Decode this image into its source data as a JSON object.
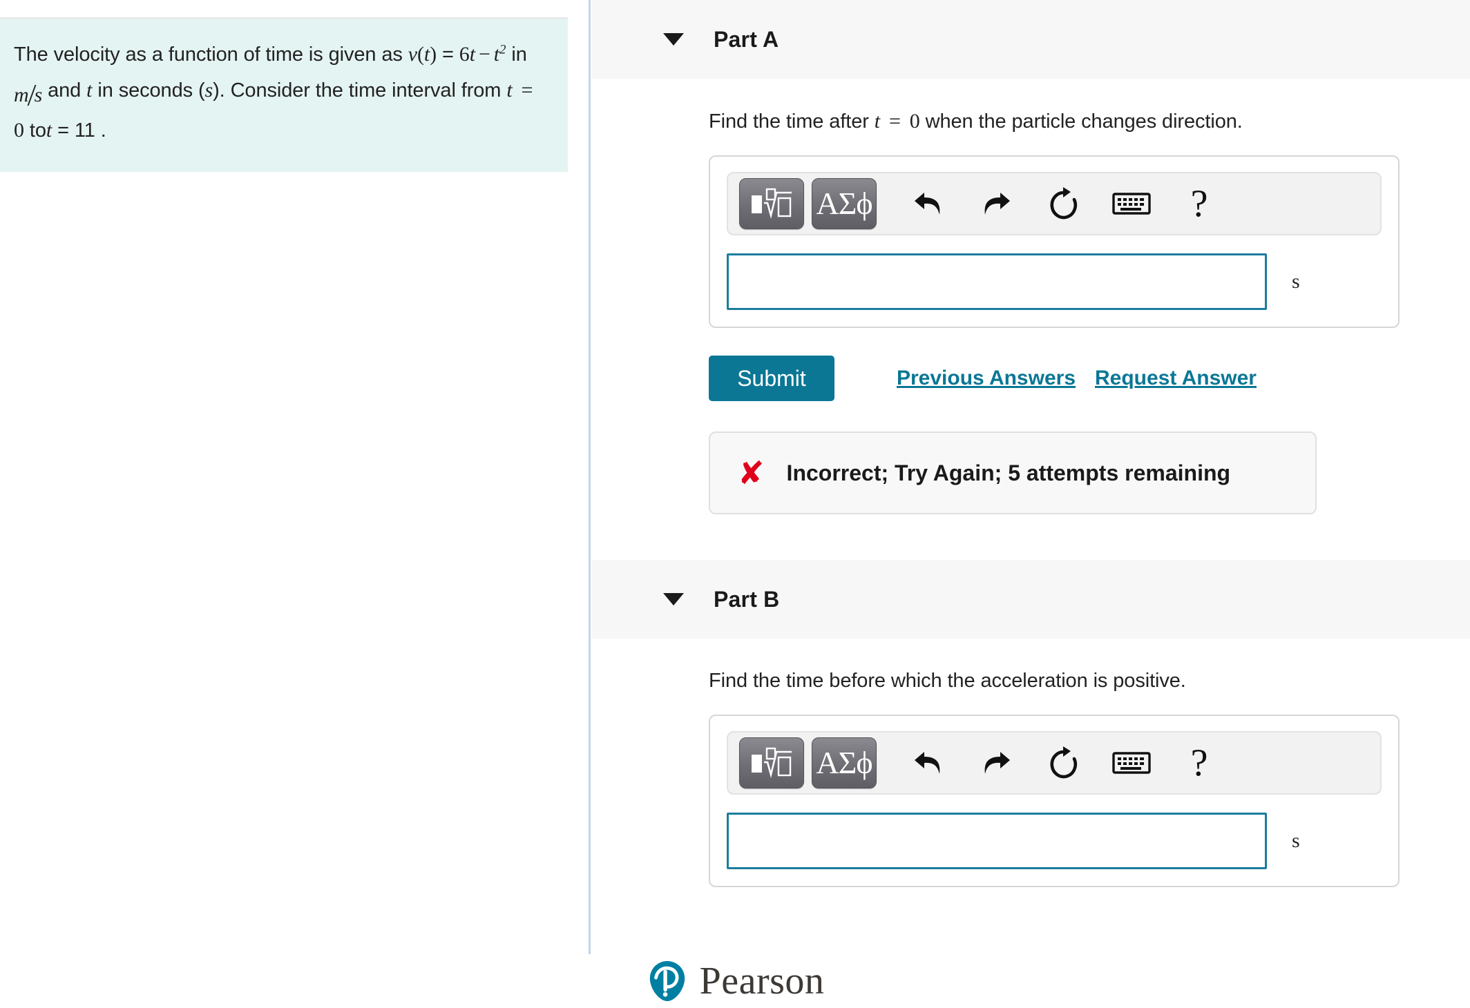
{
  "problem": {
    "statement_line1_pre": "The velocity as a function of time is given as ",
    "statement_v": "v",
    "statement_paren_t": "t",
    "statement_eq1": "=",
    "statement_line2_a": "6",
    "statement_line2_t1": "t",
    "statement_minus": "−",
    "statement_line2_t2": "t",
    "statement_exp": "2",
    "statement_in1": " in ",
    "statement_m": "m",
    "statement_s1": "s",
    "statement_and": " and ",
    "statement_t3": "t",
    "statement_seconds": " in seconds (",
    "statement_s2": "s",
    "statement_consider": "). Consider the time interval from ",
    "statement_t4": "t",
    "statement_eq2": "=",
    "statement_zero": "0",
    "statement_to": " to",
    "statement_t5": "t",
    "statement_eq3": "= 11 ",
    "statement_period": "."
  },
  "parts": [
    {
      "id": "part-a",
      "header_label": "Part A",
      "caret_icon": "caret-down-icon",
      "question_pre": "Find the time after ",
      "question_t": "t",
      "question_eq": "=",
      "question_zero": "0",
      "question_post": " when the particle changes direction.",
      "toolbar": {
        "math_template_label": "math-template-icon",
        "greek_label": "ΑΣϕ",
        "undo_label": "undo-icon",
        "redo_label": "redo-icon",
        "reset_label": "reset-icon",
        "keyboard_label": "keyboard-icon",
        "help_label": "?"
      },
      "input_value": "",
      "input_placeholder": "",
      "unit": "s",
      "submit_label": "Submit",
      "previous_answers_label": "Previous Answers",
      "request_answer_label": "Request Answer",
      "feedback": {
        "icon": "red-x-icon",
        "text": "Incorrect; Try Again; 5 attempts remaining",
        "color": "#e0001b"
      }
    },
    {
      "id": "part-b",
      "header_label": "Part B",
      "caret_icon": "caret-down-icon",
      "question_full": "Find the time before which the acceleration is positive.",
      "toolbar": {
        "math_template_label": "math-template-icon",
        "greek_label": "ΑΣϕ",
        "undo_label": "undo-icon",
        "redo_label": "redo-icon",
        "reset_label": "reset-icon",
        "keyboard_label": "keyboard-icon",
        "help_label": "?"
      },
      "input_value": "",
      "input_placeholder": "",
      "unit": "s"
    }
  ],
  "footer": {
    "brand": "Pearson",
    "logo_icon": "pearson-p-icon"
  },
  "colors": {
    "accent_teal": "#0b7795",
    "input_border": "#1b7c9e",
    "statement_bg": "#e4f4f2",
    "header_bg": "#f7f7f7",
    "error_red": "#e0001b",
    "divider": "#c3d5e6"
  }
}
